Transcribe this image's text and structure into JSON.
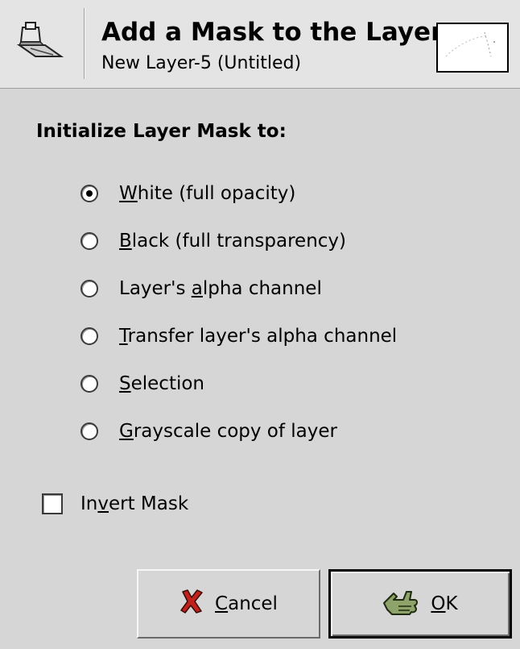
{
  "header": {
    "title": "Add a Mask to the Layer",
    "subtitle": "New Layer-5 (Untitled)",
    "icon": "layer-mask-icon",
    "thumbnail": "layer-thumbnail"
  },
  "section_label": "Initialize Layer Mask to:",
  "options": [
    {
      "pre": "",
      "mn": "W",
      "post": "hite (full opacity)",
      "checked": true
    },
    {
      "pre": "",
      "mn": "B",
      "post": "lack (full transparency)",
      "checked": false
    },
    {
      "pre": "Layer's ",
      "mn": "a",
      "post": "lpha channel",
      "checked": false
    },
    {
      "pre": "",
      "mn": "T",
      "post": "ransfer layer's alpha channel",
      "checked": false
    },
    {
      "pre": "",
      "mn": "S",
      "post": "election",
      "checked": false
    },
    {
      "pre": "",
      "mn": "G",
      "post": "rayscale copy of layer",
      "checked": false
    }
  ],
  "invert": {
    "pre": "In",
    "mn": "v",
    "post": "ert Mask",
    "checked": false
  },
  "buttons": {
    "cancel": {
      "pre": "",
      "mn": "C",
      "post": "ancel",
      "icon": "cancel-x-icon"
    },
    "ok": {
      "pre": "",
      "mn": "O",
      "post": "K",
      "icon": "ok-hand-icon"
    }
  },
  "colors": {
    "background": "#d6d6d6",
    "header_background": "#e4e4e4",
    "cancel_icon_red": "#c0211b",
    "ok_icon_green": "#8ea36a"
  }
}
